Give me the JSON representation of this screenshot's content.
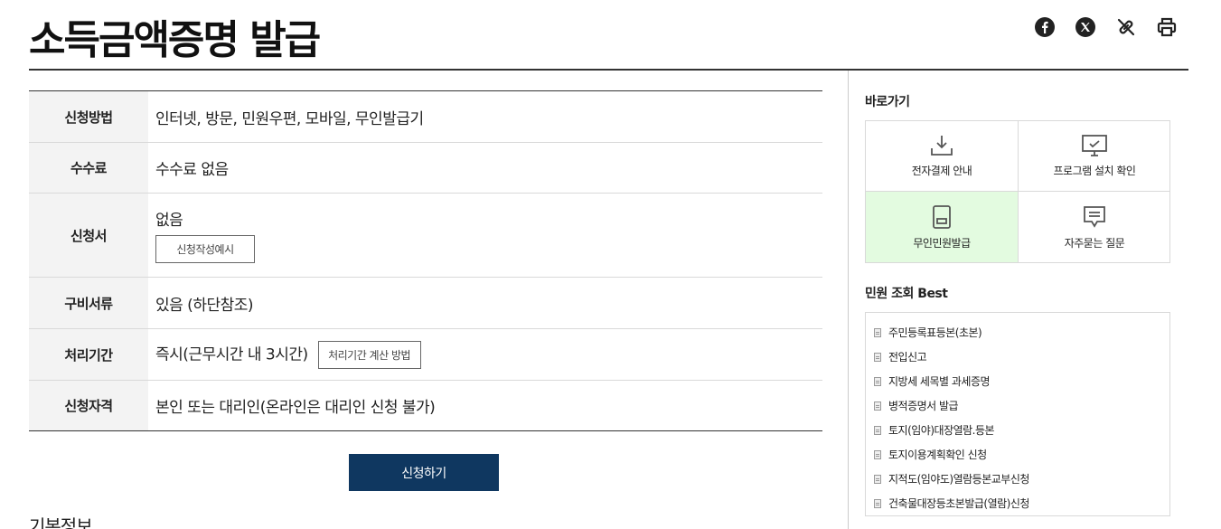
{
  "page": {
    "title": "소득금액증명 발급"
  },
  "share": {
    "icons": [
      "facebook-icon",
      "twitter-icon",
      "link-icon",
      "print-icon"
    ]
  },
  "info": {
    "rows": [
      {
        "label": "신청방법",
        "value": "인터넷, 방문, 민원우편, 모바일, 무인발급기"
      },
      {
        "label": "수수료",
        "value": "수수료 없음"
      },
      {
        "label": "신청서",
        "value": "없음",
        "button": "신청작성예시"
      },
      {
        "label": "구비서류",
        "value": "있음 (하단참조)"
      },
      {
        "label": "처리기간",
        "value": "즉시(근무시간 내 3시간)",
        "button": "처리기간 계산 방법"
      },
      {
        "label": "신청자격",
        "value": "본인 또는 대리인(온라인은 대리인 신청 불가)"
      }
    ]
  },
  "apply_button": "신청하기",
  "next_section": "기본정보",
  "quick": {
    "title": "바로가기",
    "items": [
      {
        "label": "전자결제 안내",
        "icon": "download-icon"
      },
      {
        "label": "프로그램 설치 확인",
        "icon": "monitor-check-icon"
      },
      {
        "label": "무인민원발급",
        "icon": "kiosk-icon",
        "highlight": "#e3fbe0"
      },
      {
        "label": "자주묻는 질문",
        "icon": "speech-bubble-icon"
      }
    ]
  },
  "best": {
    "title": "민원 조회 Best",
    "items": [
      "주민등록표등본(초본)",
      "전입신고",
      "지방세 세목별 과세증명",
      "병적증명서 발급",
      "토지(임야)대장열람.등본",
      "토지이용계획확인 신청",
      "지적도(임야도)열람등본교부신청",
      "건축물대장등초본발급(열람)신청"
    ]
  },
  "colors": {
    "apply_button": "#0f3760",
    "header_cell": "#f3f3f3"
  }
}
